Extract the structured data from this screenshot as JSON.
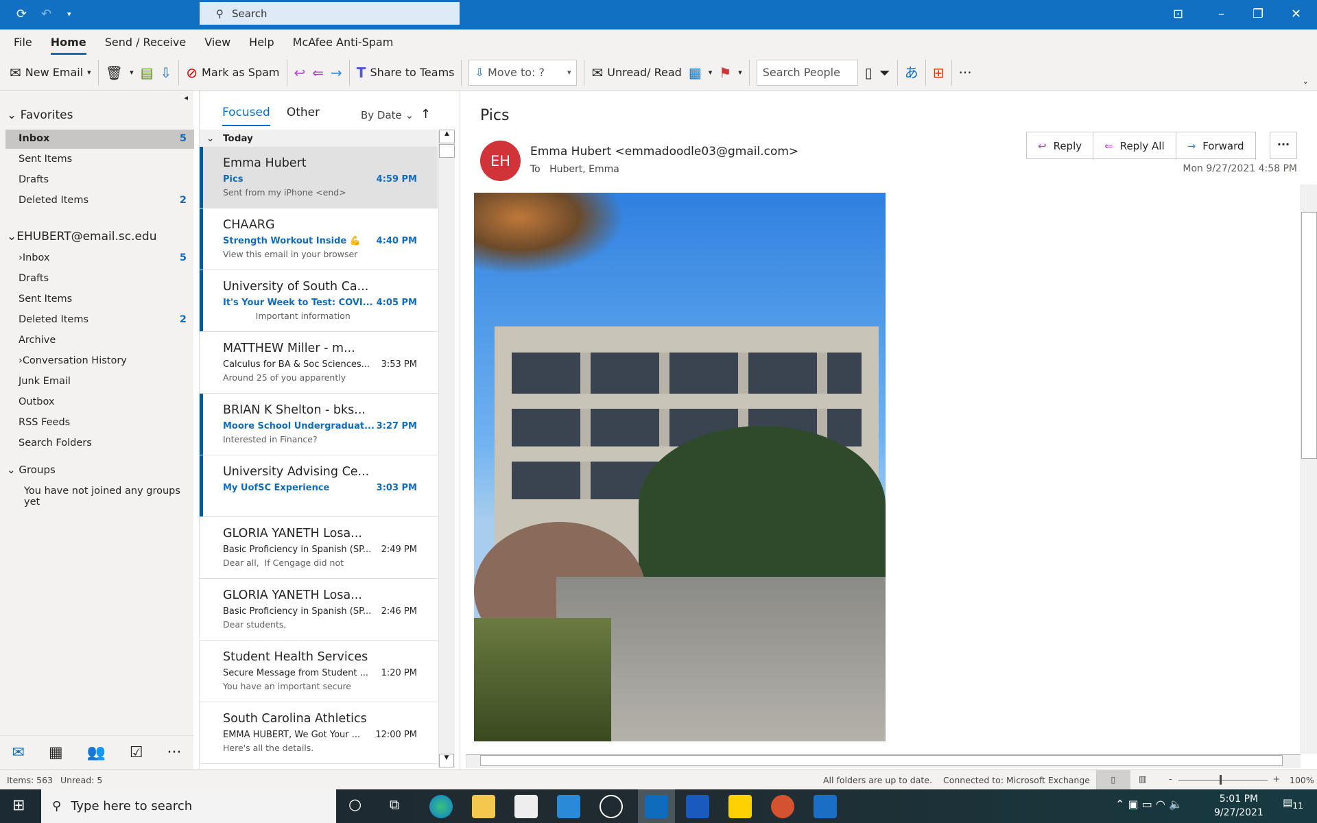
{
  "titlebar": {
    "search_placeholder": "Search"
  },
  "menu": {
    "tabs": [
      "File",
      "Home",
      "Send / Receive",
      "View",
      "Help",
      "McAfee Anti-Spam"
    ],
    "active": "Home"
  },
  "ribbon": {
    "new_email": "New Email",
    "mark_spam": "Mark as Spam",
    "share_teams": "Share to Teams",
    "move_to": "Move to: ?",
    "unread_read": "Unread/ Read",
    "search_people_placeholder": "Search People"
  },
  "folders": {
    "favorites": "Favorites",
    "fav_items": [
      {
        "label": "Inbox",
        "count": "5"
      },
      {
        "label": "Sent Items",
        "count": ""
      },
      {
        "label": "Drafts",
        "count": ""
      },
      {
        "label": "Deleted Items",
        "count": "2"
      }
    ],
    "account": "EHUBERT@email.sc.edu",
    "acct_items": [
      {
        "label": "Inbox",
        "count": "5"
      },
      {
        "label": "Drafts",
        "count": ""
      },
      {
        "label": "Sent Items",
        "count": ""
      },
      {
        "label": "Deleted Items",
        "count": "2"
      },
      {
        "label": "Archive",
        "count": ""
      },
      {
        "label": "Conversation History",
        "count": ""
      },
      {
        "label": "Junk Email",
        "count": ""
      },
      {
        "label": "Outbox",
        "count": ""
      },
      {
        "label": "RSS Feeds",
        "count": ""
      },
      {
        "label": "Search Folders",
        "count": ""
      }
    ],
    "groups": "Groups",
    "groups_note": "You have not joined any groups yet"
  },
  "list": {
    "tab_focused": "Focused",
    "tab_other": "Other",
    "sort": "By Date",
    "group_header": "Today",
    "messages": [
      {
        "from": "Emma Hubert",
        "subject": "Pics",
        "time": "4:59 PM",
        "preview": "Sent from my iPhone <end>",
        "unread": true,
        "selected": true
      },
      {
        "from": "CHAARG",
        "subject": "Strength Workout Inside 💪",
        "time": "4:40 PM",
        "preview": "View this email in your browser",
        "unread": true
      },
      {
        "from": "University of South Ca...",
        "subject": "It's Your Week to Test: COVI...",
        "time": "4:05 PM",
        "preview": "            Important information",
        "unread": true
      },
      {
        "from": "MATTHEW Miller - m...",
        "subject": "Calculus for BA & Soc Sciences...",
        "time": "3:53 PM",
        "preview": "Around 25 of you apparently",
        "unread": false
      },
      {
        "from": "BRIAN K Shelton - bks...",
        "subject": "Moore School Undergraduat...",
        "time": "3:27 PM",
        "preview": "Interested in Finance?",
        "unread": true
      },
      {
        "from": "University Advising Ce...",
        "subject": "My UofSC Experience",
        "time": "3:03 PM",
        "preview": "",
        "unread": true
      },
      {
        "from": "GLORIA YANETH Losa...",
        "subject": "Basic Proficiency in Spanish (SP...",
        "time": "2:49 PM",
        "preview": "Dear all,  If Cengage did not",
        "unread": false
      },
      {
        "from": "GLORIA YANETH Losa...",
        "subject": "Basic Proficiency in Spanish (SP...",
        "time": "2:46 PM",
        "preview": "Dear students,",
        "unread": false
      },
      {
        "from": "Student Health Services",
        "subject": "Secure Message from Student ...",
        "time": "1:20 PM",
        "preview": "You have an important secure",
        "unread": false
      },
      {
        "from": "South Carolina Athletics",
        "subject": "EMMA HUBERT, We Got Your ...",
        "time": "12:00 PM",
        "preview": "Here's all the details.",
        "unread": false
      }
    ]
  },
  "reading": {
    "subject": "Pics",
    "avatar_initials": "EH",
    "avatar_color": "#d13438",
    "sender": "Emma Hubert <emmadoodle03@gmail.com>",
    "to_label": "To",
    "to": "Hubert, Emma",
    "reply": "Reply",
    "reply_all": "Reply All",
    "forward": "Forward",
    "date": "Mon 9/27/2021 4:58 PM"
  },
  "status": {
    "items": "Items: 563",
    "unread": "Unread: 5",
    "sync": "All folders are up to date.",
    "connection": "Connected to: Microsoft Exchange",
    "zoom": "100%"
  },
  "taskbar": {
    "search_placeholder": "Type here to search",
    "time": "5:01 PM",
    "date": "9/27/2021",
    "notifications": "11"
  },
  "colors": {
    "accent": "#0f6cbd",
    "titlebar": "#1170c2"
  }
}
